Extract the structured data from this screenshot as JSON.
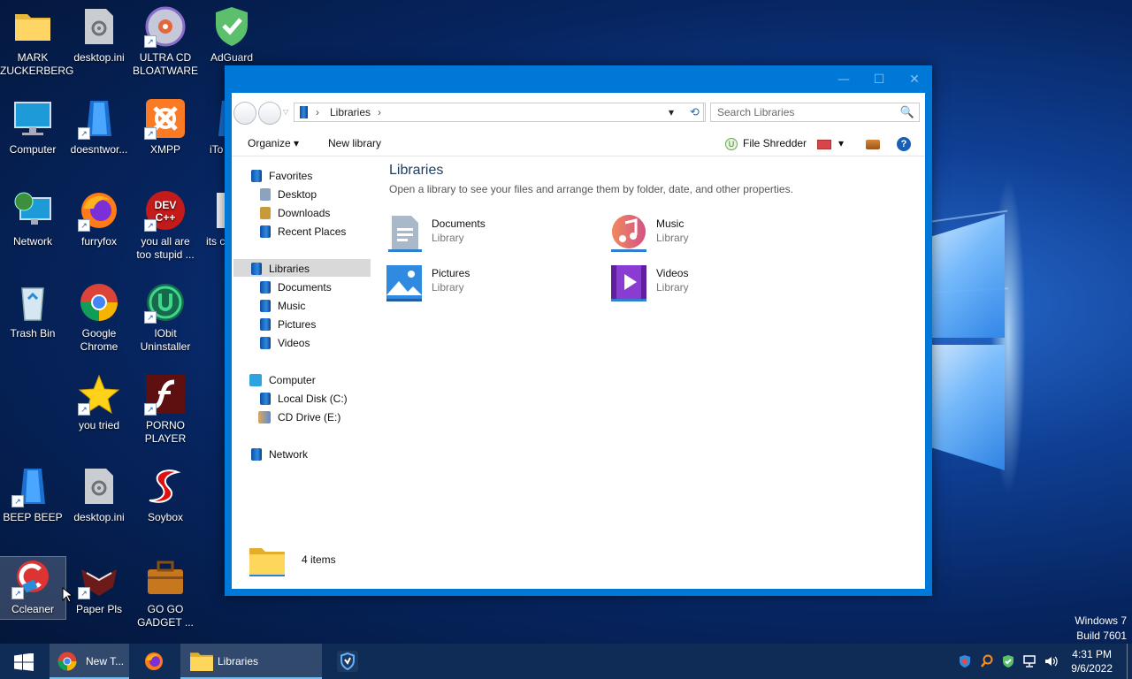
{
  "desktop": {
    "icons": [
      {
        "label": "MARK ZUCKERBERG",
        "icon": "folder-icon"
      },
      {
        "label": "desktop.ini",
        "icon": "settings-file-icon"
      },
      {
        "label": "ULTRA CD BLOATWARE",
        "icon": "cd-icon"
      },
      {
        "label": "AdGuard",
        "icon": "shield-icon"
      },
      {
        "label": "Computer",
        "icon": "computer-icon"
      },
      {
        "label": "doesntwor...",
        "icon": "blue-file-icon"
      },
      {
        "label": "XMPP",
        "icon": "xampp-icon"
      },
      {
        "label": "iTo",
        "icon": "partial-icon"
      },
      {
        "label": "Network",
        "icon": "network-icon"
      },
      {
        "label": "furryfox",
        "icon": "firefox-icon"
      },
      {
        "label": "you all are too stupid ...",
        "icon": "devcpp-icon"
      },
      {
        "label": "its c",
        "icon": "partial-icon"
      },
      {
        "label": "Trash Bin",
        "icon": "recycle-bin-icon"
      },
      {
        "label": "Google Chrome",
        "icon": "chrome-icon"
      },
      {
        "label": "IObit Uninstaller",
        "icon": "iobit-icon"
      },
      {
        "label": "you tried",
        "icon": "star-icon"
      },
      {
        "label": "PORNO PLAYER",
        "icon": "flash-icon"
      },
      {
        "label": "BEEP BEEP",
        "icon": "blue-file-icon"
      },
      {
        "label": "desktop.ini",
        "icon": "settings-file-icon"
      },
      {
        "label": "Soybox",
        "icon": "soybox-icon"
      },
      {
        "label": "Ccleaner",
        "icon": "ccleaner-icon"
      },
      {
        "label": "Paper Pls",
        "icon": "paperspls-icon"
      },
      {
        "label": "GO GO GADGET ...",
        "icon": "briefcase-icon"
      }
    ]
  },
  "window": {
    "title_buttons": {
      "minimize": "—",
      "maximize": "☐",
      "close": "✕"
    },
    "address": {
      "root_arrow": "›",
      "path": "Libraries",
      "tail_arrow": "›",
      "dropdown": "▾",
      "refresh": "⟲"
    },
    "search": {
      "placeholder": "Search Libraries",
      "icon": "🔍"
    },
    "toolbar": {
      "organize": "Organize ▾",
      "new_library": "New library",
      "file_shredder": "File Shredder",
      "dropdown": "▾",
      "help": "?"
    },
    "nav": {
      "favorites": "Favorites",
      "desktop": "Desktop",
      "downloads": "Downloads",
      "recent": "Recent Places",
      "libraries": "Libraries",
      "documents": "Documents",
      "music": "Music",
      "pictures": "Pictures",
      "videos": "Videos",
      "computer": "Computer",
      "local_disk": "Local Disk (C:)",
      "cd_drive": "CD Drive (E:)",
      "network": "Network"
    },
    "content": {
      "title": "Libraries",
      "subtitle": "Open a library to see your files and arrange them by folder, date, and other properties.",
      "libraries": [
        {
          "name": "Documents",
          "type": "Library"
        },
        {
          "name": "Music",
          "type": "Library"
        },
        {
          "name": "Pictures",
          "type": "Library"
        },
        {
          "name": "Videos",
          "type": "Library"
        }
      ]
    },
    "details": {
      "count": "4 items"
    }
  },
  "taskbar": {
    "chrome_label": "New T...",
    "explorer_label": "Libraries",
    "clock_time": "4:31 PM",
    "clock_date": "9/6/2022"
  },
  "watermark": {
    "line1": "Windows 7",
    "line2": "Build 7601"
  }
}
